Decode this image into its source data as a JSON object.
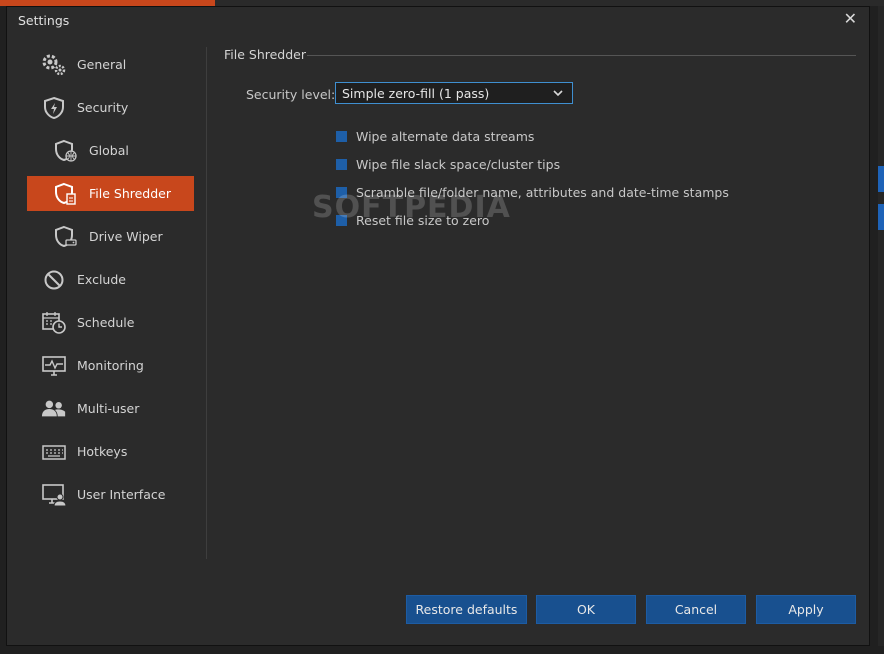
{
  "dialog": {
    "title": "Settings",
    "close_glyph": "✕"
  },
  "sidebar": {
    "items": [
      {
        "label": "General",
        "icon": "gear-icon"
      },
      {
        "label": "Security",
        "icon": "shield-icon"
      },
      {
        "label": "Global",
        "icon": "shield-globe-icon"
      },
      {
        "label": "File Shredder",
        "icon": "shield-file-icon"
      },
      {
        "label": "Drive Wiper",
        "icon": "shield-drive-icon"
      },
      {
        "label": "Exclude",
        "icon": "block-icon"
      },
      {
        "label": "Schedule",
        "icon": "calendar-clock-icon"
      },
      {
        "label": "Monitoring",
        "icon": "monitor-pulse-icon"
      },
      {
        "label": "Multi-user",
        "icon": "users-icon"
      },
      {
        "label": "Hotkeys",
        "icon": "keyboard-icon"
      },
      {
        "label": "User Interface",
        "icon": "monitor-user-icon"
      }
    ],
    "active_index": 3
  },
  "main": {
    "section_title": "File Shredder",
    "security_level_label": "Security level:",
    "security_level_value": "Simple zero-fill (1 pass)",
    "options": [
      {
        "label": "Wipe alternate data streams",
        "checked": true
      },
      {
        "label": "Wipe file slack space/cluster tips",
        "checked": true
      },
      {
        "label": "Scramble file/folder name, attributes and date-time stamps",
        "checked": true
      },
      {
        "label": "Reset file size to zero",
        "checked": true
      }
    ]
  },
  "buttons": {
    "restore": "Restore defaults",
    "ok": "OK",
    "cancel": "Cancel",
    "apply": "Apply"
  },
  "watermark": "SOFTPEDIA",
  "colors": {
    "accent": "#c8471c",
    "button": "#18508f",
    "checkbox": "#1e5fa8",
    "focus": "#3f8fd0"
  }
}
